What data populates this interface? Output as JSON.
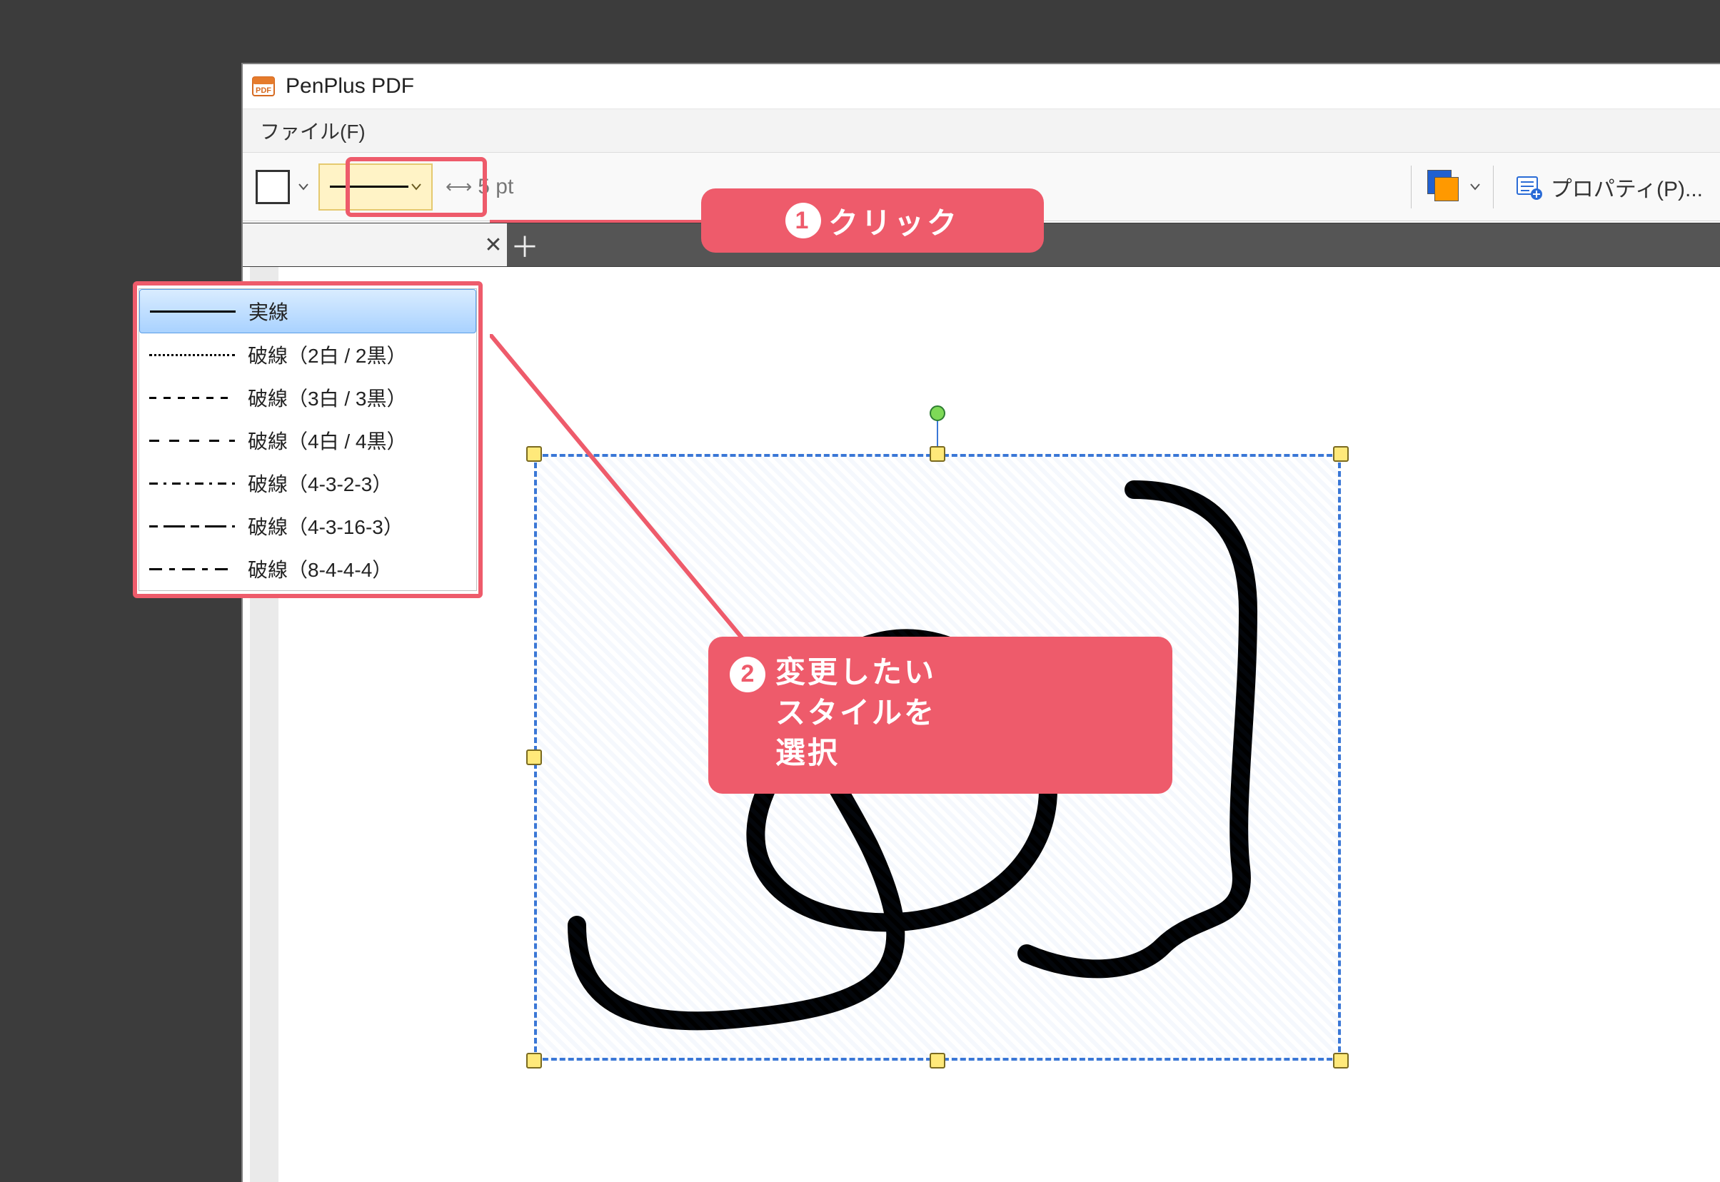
{
  "titlebar": {
    "app_name": "PenPlus PDF"
  },
  "menubar": {
    "file_label": "ファイル(F)"
  },
  "toolbar": {
    "width_value": "5 pt",
    "properties_label": "プロパティ(P)..."
  },
  "tabs": {
    "close_glyph": "✕",
    "add_glyph": "＋"
  },
  "callouts": {
    "c1_badge": "1",
    "c1_text": "クリック",
    "c2_badge": "2",
    "c2_text": "変更したい\nスタイルを\n選択"
  },
  "line_styles": [
    {
      "label": "実線",
      "class": "solid-line",
      "selected": true
    },
    {
      "label": "破線（2白 / 2黒）",
      "class": "dot-line",
      "selected": false
    },
    {
      "label": "破線（3白 / 3黒）",
      "class": "dash-3",
      "selected": false
    },
    {
      "label": "破線（4白 / 4黒）",
      "class": "dash-4",
      "selected": false
    },
    {
      "label": "破線（4-3-2-3）",
      "class": "dash-4323",
      "selected": false
    },
    {
      "label": "破線（4-3-16-3）",
      "class": "dash-43163",
      "selected": false
    },
    {
      "label": "破線（8-4-4-4）",
      "class": "dash-8444",
      "selected": false
    }
  ]
}
